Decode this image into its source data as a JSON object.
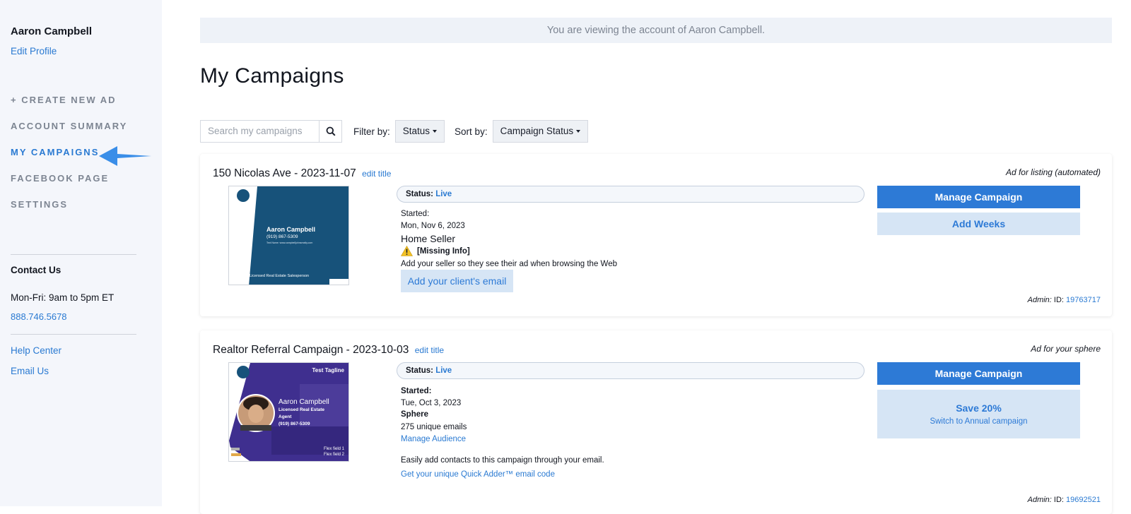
{
  "sidebar": {
    "user_name": "Aaron Campbell",
    "edit_profile": "Edit Profile",
    "nav": [
      {
        "label": "+ CREATE NEW AD"
      },
      {
        "label": "ACCOUNT SUMMARY"
      },
      {
        "label": "MY CAMPAIGNS"
      },
      {
        "label": "FACEBOOK PAGE"
      },
      {
        "label": "SETTINGS"
      }
    ],
    "contact_title": "Contact Us",
    "hours": "Mon-Fri: 9am to 5pm ET",
    "phone": "888.746.5678",
    "help_center": "Help Center",
    "email_us": "Email Us"
  },
  "banner": "You are viewing the account of Aaron Campbell.",
  "page_title": "My Campaigns",
  "toolbar": {
    "search_placeholder": "Search my campaigns",
    "filter_label": "Filter by:",
    "filter_value": "Status",
    "sort_label": "Sort by:",
    "sort_value": "Campaign Status"
  },
  "campaigns": [
    {
      "title": "150 Nicolas Ave - 2023-11-07",
      "edit_title": "edit title",
      "ad_type": "Ad for listing (automated)",
      "status_label": "Status:",
      "status": "Live",
      "started_label": "Started:",
      "started": "Mon, Nov 6, 2023",
      "segment": "Home Seller",
      "missing": "[Missing Info]",
      "missing_desc": "Add your seller so they see their ad when browsing the Web",
      "client_btn": "Add your client's email",
      "manage": "Manage Campaign",
      "secondary": "Add Weeks",
      "admin_label": "Admin:",
      "id_label": "ID:",
      "admin_id": "19763717",
      "thumb": {
        "name": "Aaron Campbell",
        "phone": "(919) 867-5309",
        "web": "Text Name: www.campbelljohnsrealty.com",
        "footer": "Licensed Real Estate Salesperson"
      }
    },
    {
      "title": "Realtor Referral Campaign - 2023-10-03",
      "edit_title": "edit title",
      "ad_type": "Ad for your sphere",
      "status_label": "Status:",
      "status": "Live",
      "started_label": "Started:",
      "started": "Tue, Oct 3, 2023",
      "segment": "Sphere",
      "emails": "275 unique emails",
      "manage_audience": "Manage Audience",
      "easy_add": "Easily add contacts to this campaign through your email.",
      "quick_adder": "Get your unique Quick Adder™ email code",
      "manage": "Manage Campaign",
      "secondary": "Save 20%",
      "secondary_sub": "Switch to Annual campaign",
      "admin_label": "Admin:",
      "id_label": "ID:",
      "admin_id": "19692521",
      "thumb": {
        "tagline": "Test Tagline",
        "name": "Aaron Campbell",
        "title1": "Licensed Real Estate",
        "title2": "Agent",
        "phone": "(919) 867-5309",
        "flex1": "Flex field 1",
        "flex2": "Flex field 2"
      }
    }
  ],
  "colors": {
    "accent": "#2d7ad6",
    "light_button": "#d6e5f5",
    "sidebar_bg": "#f4f6fb",
    "arrow": "#3a8ee8"
  }
}
